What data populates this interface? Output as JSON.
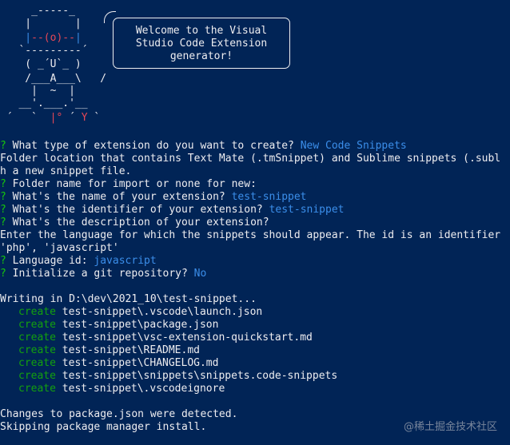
{
  "ascii_art": {
    "robot": [
      "     _-----_",
      "    |       |",
      "    |--(o)--|",
      "   `---------´",
      "    ( _´U`_ )",
      "    /___A___\\   /",
      "     |  ~  |",
      "   __'.___.'__",
      " ´   `  |° ´ Y `"
    ],
    "speech_bubble": [
      "Welcome to the Visual",
      "Studio Code Extension",
      "generator!"
    ]
  },
  "prompts": [
    {
      "mark": "?",
      "question": "What type of extension do you want to create?",
      "answer": "New Code Snippets"
    },
    {
      "text": "Folder location that contains Text Mate (.tmSnippet) and Sublime snippets (.subl"
    },
    {
      "text": "h a new snippet file."
    },
    {
      "mark": "?",
      "question": "Folder name for import or none for new:",
      "answer": ""
    },
    {
      "mark": "?",
      "question": "What's the name of your extension?",
      "answer": "test-snippet"
    },
    {
      "mark": "?",
      "question": "What's the identifier of your extension?",
      "answer": "test-snippet"
    },
    {
      "mark": "?",
      "question": "What's the description of your extension?",
      "answer": ""
    },
    {
      "text": "Enter the language for which the snippets should appear. The id is an identifier"
    },
    {
      "text": "'php', 'javascript'"
    },
    {
      "mark": "?",
      "question": "Language id:",
      "answer": "javascript"
    },
    {
      "mark": "?",
      "question": "Initialize a git repository?",
      "answer": "No"
    }
  ],
  "writing_line": "Writing in D:\\dev\\2021_10\\test-snippet...",
  "create_verb": "create",
  "created_files": [
    "test-snippet\\.vscode\\launch.json",
    "test-snippet\\package.json",
    "test-snippet\\vsc-extension-quickstart.md",
    "test-snippet\\README.md",
    "test-snippet\\CHANGELOG.md",
    "test-snippet\\snippets\\snippets.code-snippets",
    "test-snippet\\.vscodeignore"
  ],
  "footer_lines": [
    "Changes to package.json were detected.",
    "Skipping package manager install."
  ],
  "watermark": "@稀土掘金技术社区",
  "colors": {
    "background": "#012456",
    "text": "#eeedf0",
    "question_mark": "#16c60c",
    "answer": "#3b8eea",
    "create": "#13a10e",
    "robot_blue": "#3b8eea",
    "robot_red": "#e74856"
  }
}
